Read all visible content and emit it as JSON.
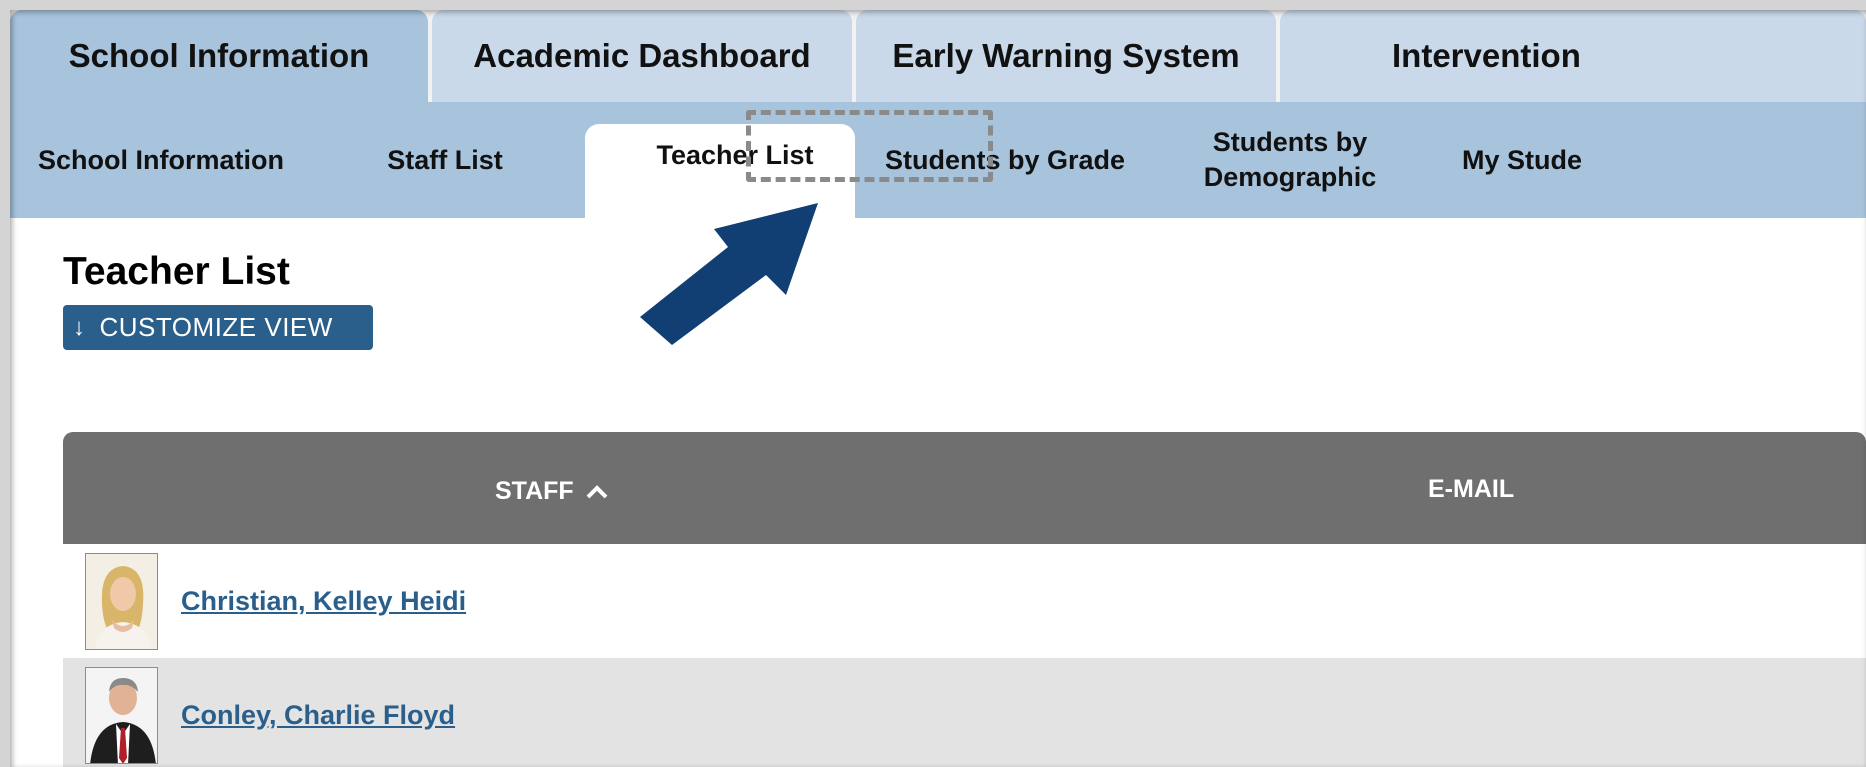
{
  "top_tabs": [
    {
      "label": "School Information",
      "active": true
    },
    {
      "label": "Academic Dashboard",
      "active": false
    },
    {
      "label": "Early Warning System",
      "active": false
    },
    {
      "label": "Intervention",
      "active": false
    }
  ],
  "sub_tabs": [
    {
      "label": "School Information"
    },
    {
      "label": "Staff List"
    },
    {
      "label": "Teacher List",
      "active": true
    },
    {
      "label": "Students by Grade"
    },
    {
      "label": "Students by Demographic",
      "line1": "Students by",
      "line2": "Demographic"
    },
    {
      "label": "My Stude"
    }
  ],
  "page": {
    "title": "Teacher List",
    "customize_label": "CUSTOMIZE VIEW"
  },
  "table": {
    "headers": {
      "staff": "STAFF",
      "email": "E-MAIL"
    },
    "rows": [
      {
        "name": "Christian, Kelley Heidi",
        "email": ""
      },
      {
        "name": "Conley, Charlie Floyd",
        "email": ""
      }
    ]
  },
  "colors": {
    "tab_inactive": "#c9d9e9",
    "tab_active": "#a8c3dc",
    "accent": "#2a5f8c",
    "arrow": "#123f73",
    "table_header": "#6f6f6f",
    "row_alt": "#e3e3e3"
  },
  "icons": [
    "down-arrow-icon",
    "sort-ascending-icon",
    "pointer-arrow-icon"
  ]
}
